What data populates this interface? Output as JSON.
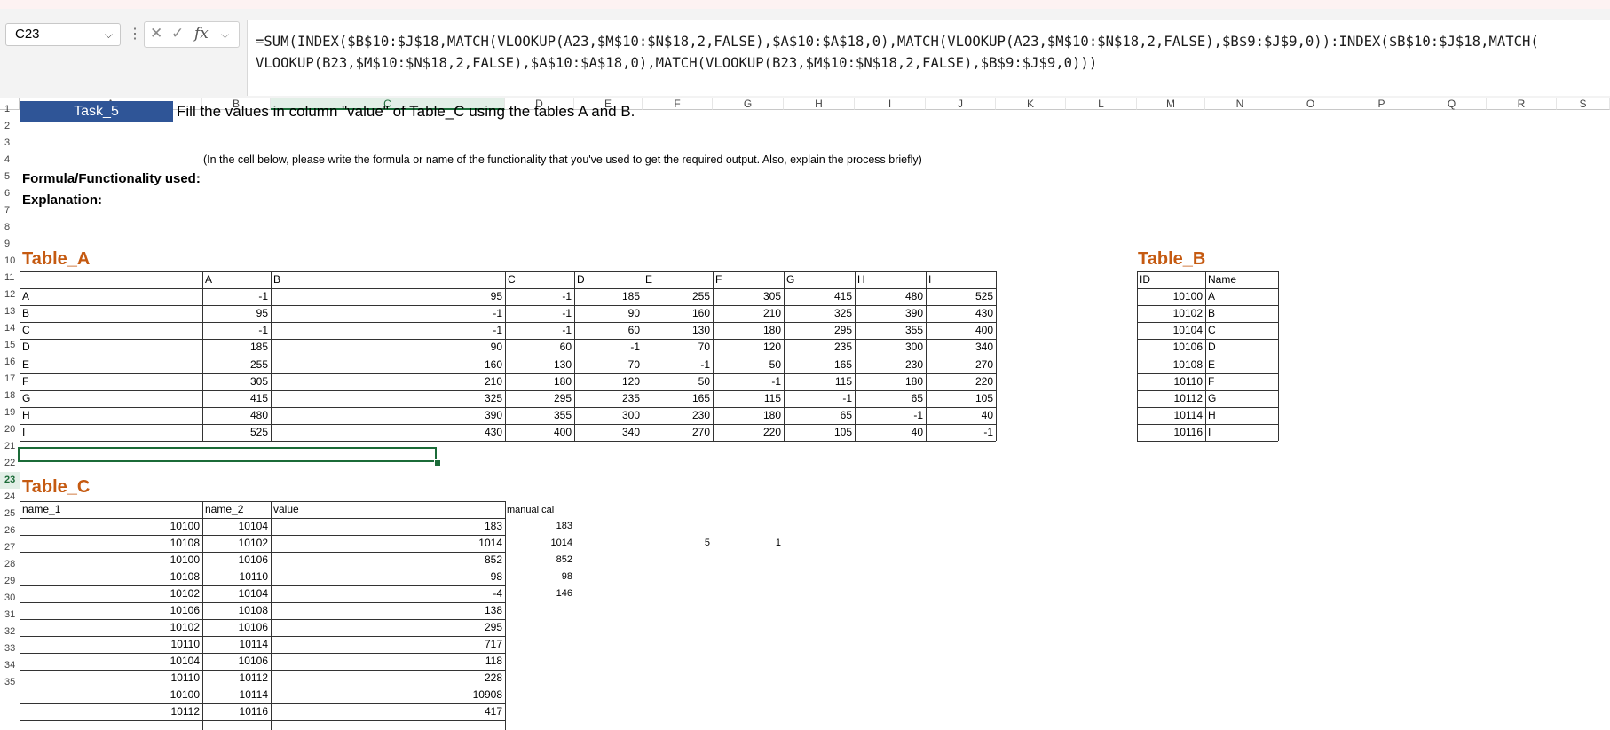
{
  "formula_bar": {
    "name_box": "C23",
    "fx_label": "fx",
    "formula_line1": "=SUM(INDEX($B$10:$J$18,MATCH(VLOOKUP(A23,$M$10:$N$18,2,FALSE),$A$10:$A$18,0),MATCH(VLOOKUP(A23,$M$10:$N$18,2,FALSE),$B$9:$J$9,0)):INDEX($B$10:$J$18,MATCH(",
    "formula_line2": "VLOOKUP(B23,$M$10:$N$18,2,FALSE),$A$10:$A$18,0),MATCH(VLOOKUP(B23,$M$10:$N$18,2,FALSE),$B$9:$J$9,0)))"
  },
  "columns": [
    "A",
    "B",
    "C",
    "D",
    "E",
    "F",
    "G",
    "H",
    "I",
    "J",
    "K",
    "L",
    "M",
    "N",
    "O",
    "P",
    "Q",
    "R",
    "S"
  ],
  "rows": [
    "1",
    "2",
    "3",
    "4",
    "5",
    "6",
    "7",
    "8",
    "9",
    "10",
    "11",
    "12",
    "13",
    "14",
    "15",
    "16",
    "17",
    "18",
    "19",
    "20",
    "21",
    "22",
    "23",
    "24",
    "25",
    "26",
    "27",
    "28",
    "29",
    "30",
    "31",
    "32",
    "33",
    "34",
    "35"
  ],
  "sheet": {
    "task_label": "Task_5",
    "task_desc": "Fill the values in column \"value\" of Table_C using the tables A and B.",
    "instruction": "(In the cell below, please write the formula or name of the functionality that you've used to get the required output. Also, explain the process briefly)",
    "formula_used_label": "Formula/Functionality used:",
    "explanation_label": "Explanation:"
  },
  "table_a": {
    "title": "Table_A",
    "headers": [
      "A",
      "B",
      "C",
      "D",
      "E",
      "F",
      "G",
      "H",
      "I"
    ],
    "row_labels": [
      "A",
      "B",
      "C",
      "D",
      "E",
      "F",
      "G",
      "H",
      "I"
    ],
    "values": [
      [
        "-1",
        "95",
        "-1",
        "185",
        "255",
        "305",
        "415",
        "480",
        "525"
      ],
      [
        "95",
        "-1",
        "-1",
        "90",
        "160",
        "210",
        "325",
        "390",
        "430"
      ],
      [
        "-1",
        "-1",
        "-1",
        "60",
        "130",
        "180",
        "295",
        "355",
        "400"
      ],
      [
        "185",
        "90",
        "60",
        "-1",
        "70",
        "120",
        "235",
        "300",
        "340"
      ],
      [
        "255",
        "160",
        "130",
        "70",
        "-1",
        "50",
        "165",
        "230",
        "270"
      ],
      [
        "305",
        "210",
        "180",
        "120",
        "50",
        "-1",
        "115",
        "180",
        "220"
      ],
      [
        "415",
        "325",
        "295",
        "235",
        "165",
        "115",
        "-1",
        "65",
        "105"
      ],
      [
        "480",
        "390",
        "355",
        "300",
        "230",
        "180",
        "65",
        "-1",
        "40"
      ],
      [
        "525",
        "430",
        "400",
        "340",
        "270",
        "220",
        "105",
        "40",
        "-1"
      ]
    ]
  },
  "table_b": {
    "title": "Table_B",
    "headers": [
      "ID",
      "Name"
    ],
    "rows": [
      [
        "10100",
        "A"
      ],
      [
        "10102",
        "B"
      ],
      [
        "10104",
        "C"
      ],
      [
        "10106",
        "D"
      ],
      [
        "10108",
        "E"
      ],
      [
        "10110",
        "F"
      ],
      [
        "10112",
        "G"
      ],
      [
        "10114",
        "H"
      ],
      [
        "10116",
        "I"
      ]
    ]
  },
  "table_c": {
    "title": "Table_C",
    "headers": [
      "name_1",
      "name_2",
      "value"
    ],
    "rows": [
      [
        "10100",
        "10104",
        "183"
      ],
      [
        "10108",
        "10102",
        "1014"
      ],
      [
        "10100",
        "10106",
        "852"
      ],
      [
        "10108",
        "10110",
        "98"
      ],
      [
        "10102",
        "10104",
        "-4"
      ],
      [
        "10106",
        "10108",
        "138"
      ],
      [
        "10102",
        "10106",
        "295"
      ],
      [
        "10110",
        "10114",
        "717"
      ],
      [
        "10104",
        "10106",
        "118"
      ],
      [
        "10110",
        "10112",
        "228"
      ],
      [
        "10100",
        "10114",
        "10908"
      ],
      [
        "10112",
        "10116",
        "417"
      ]
    ]
  },
  "manual_cal": {
    "header": "manual cal",
    "values": [
      "183",
      "1014",
      "852",
      "98",
      "146"
    ]
  },
  "extra_cells": {
    "f24": "5",
    "g24": "1"
  }
}
